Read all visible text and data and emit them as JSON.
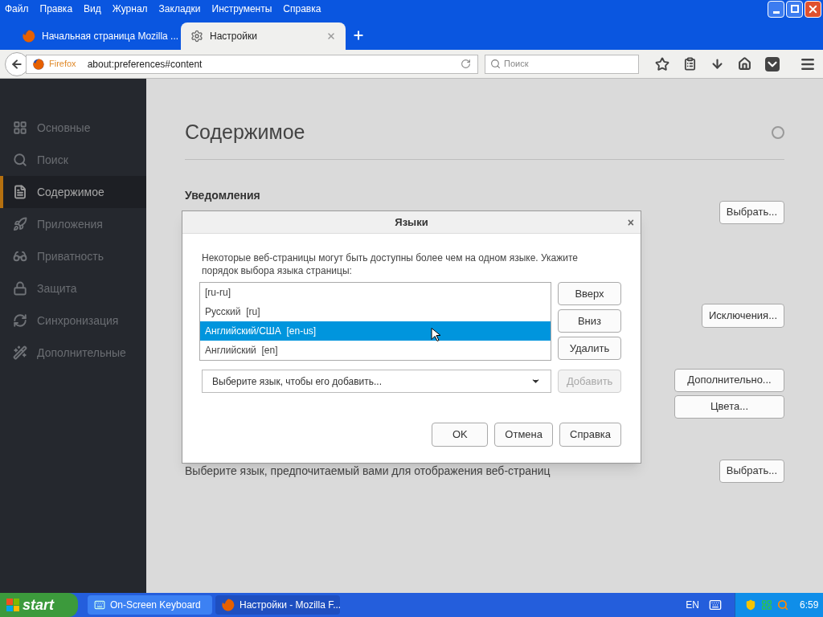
{
  "menu_bar": [
    "Файл",
    "Правка",
    "Вид",
    "Журнал",
    "Закладки",
    "Инструменты",
    "Справка"
  ],
  "tabs": [
    {
      "label": "Начальная страница Mozilla ...",
      "selected": false,
      "kind": "firefox"
    },
    {
      "label": "Настройки",
      "selected": true,
      "kind": "settings"
    }
  ],
  "nav_bar": {
    "identity": "Firefox",
    "url": "about:preferences#content",
    "search_placeholder": "Поиск"
  },
  "sidebar": {
    "items": [
      {
        "label": "Основные",
        "selected": false
      },
      {
        "label": "Поиск",
        "selected": false
      },
      {
        "label": "Содержимое",
        "selected": true
      },
      {
        "label": "Приложения",
        "selected": false
      },
      {
        "label": "Приватность",
        "selected": false
      },
      {
        "label": "Защита",
        "selected": false
      },
      {
        "label": "Синхронизация",
        "selected": false
      },
      {
        "label": "Дополнительные",
        "selected": false
      }
    ]
  },
  "page": {
    "title": "Содержимое",
    "notifications_heading": "Уведомления",
    "notifications_button": "Выбрать...",
    "exceptions_button": "Исключения...",
    "advanced_button": "Дополнительно...",
    "colors_button": "Цвета...",
    "language_text": "Выберите язык, предпочитаемый вами для отображения веб-страниц",
    "language_button": "Выбрать..."
  },
  "dialog": {
    "title": "Языки",
    "close": "×",
    "description": "Некоторые веб-страницы могут быть доступны более чем на одном языке. Укажите порядок выбора языка страницы:",
    "languages": [
      {
        "label": "[ru-ru]",
        "selected": false
      },
      {
        "label": "Русский  [ru]",
        "selected": false
      },
      {
        "label": "Английский/США  [en-us]",
        "selected": true
      },
      {
        "label": "Английский  [en]",
        "selected": false
      }
    ],
    "side_buttons": [
      {
        "label": "Вверх",
        "disabled": false
      },
      {
        "label": "Вниз",
        "disabled": false
      },
      {
        "label": "Удалить",
        "disabled": false
      }
    ],
    "add_select": "Выберите язык, чтобы его добавить...",
    "add_button": {
      "label": "Добавить",
      "disabled": true
    },
    "footer_buttons": [
      "OK",
      "Отмена",
      "Справка"
    ]
  },
  "taskbar": {
    "start": "start",
    "tasks": [
      {
        "label": "On-Screen Keyboard",
        "selected": false,
        "kind": "keyboard"
      },
      {
        "label": "Настройки - Mozilla F...",
        "selected": true,
        "kind": "firefox"
      }
    ],
    "language": "EN",
    "time": "6:59"
  }
}
